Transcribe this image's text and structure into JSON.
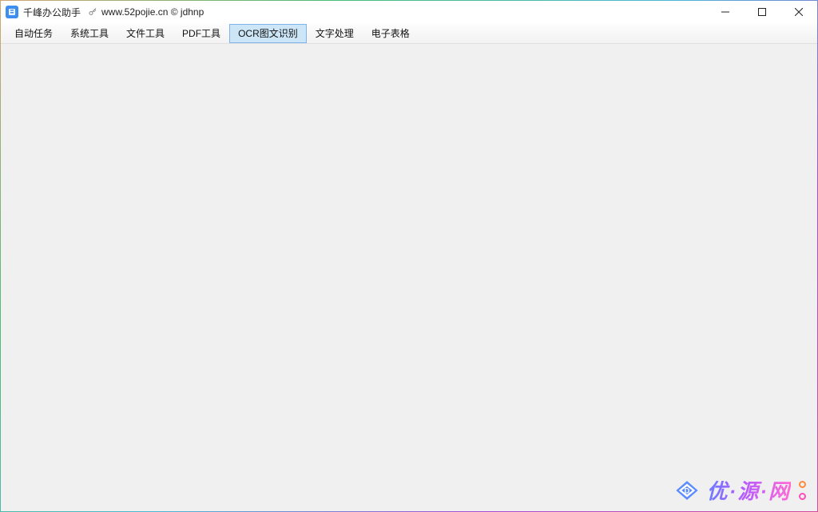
{
  "titlebar": {
    "app_name": "千峰办公助手",
    "subtitle": "www.52pojie.cn © jdhnp"
  },
  "menu": {
    "items": [
      {
        "label": "自动任务"
      },
      {
        "label": "系统工具"
      },
      {
        "label": "文件工具"
      },
      {
        "label": "PDF工具"
      },
      {
        "label": "OCR图文识别",
        "active": true
      },
      {
        "label": "文字处理"
      },
      {
        "label": "电子表格"
      }
    ]
  },
  "watermark": {
    "text": "优·源·网"
  }
}
